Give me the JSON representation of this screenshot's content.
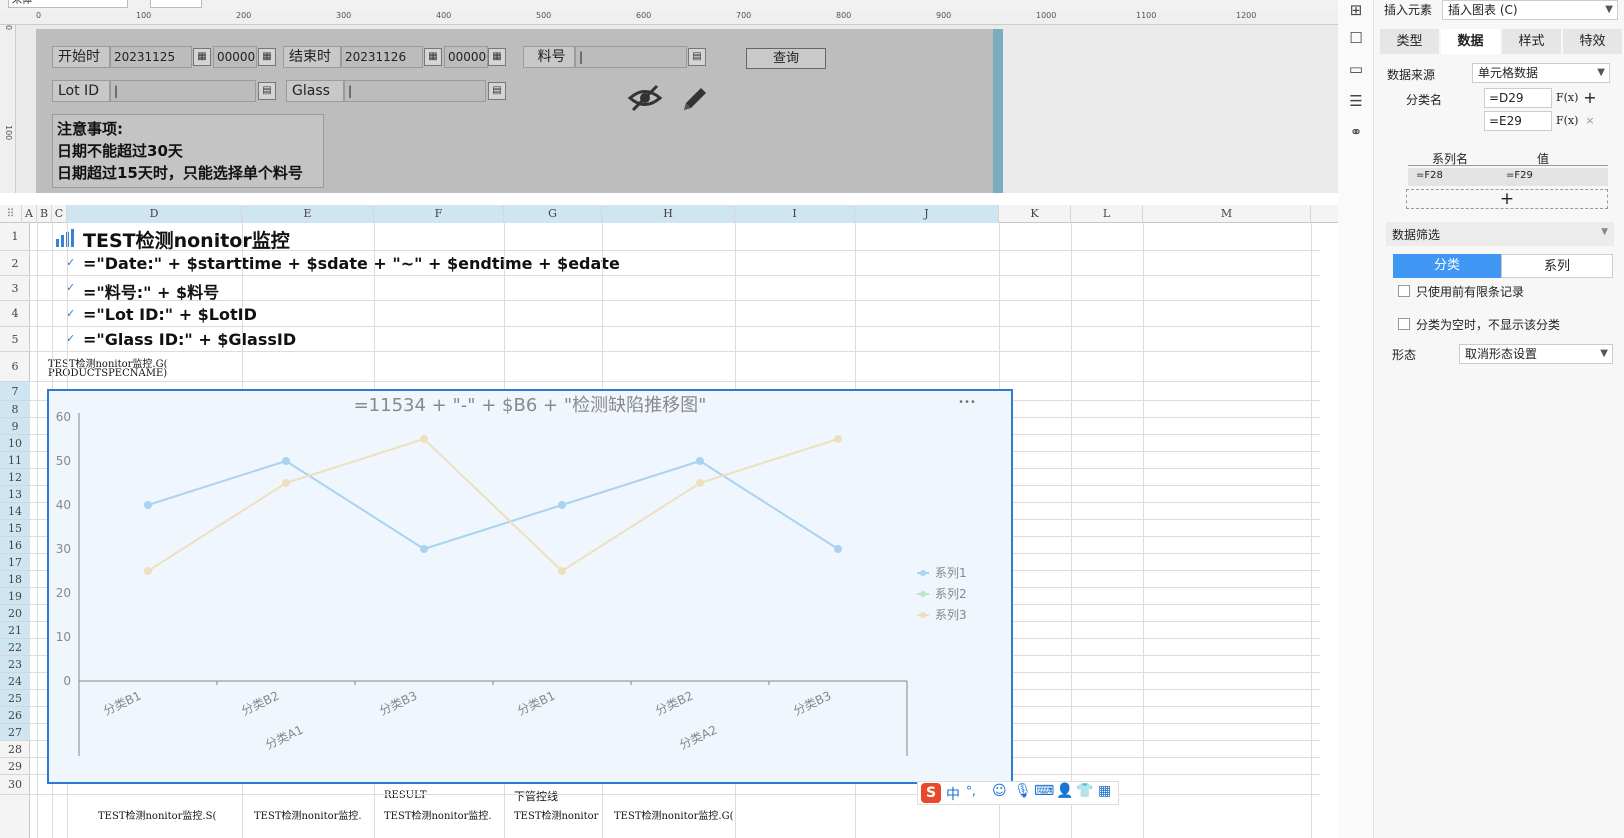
{
  "toolbar": {
    "font_name": "宋体"
  },
  "ruler": {
    "ticks": [
      "0",
      "100",
      "200",
      "300",
      "400",
      "500",
      "600",
      "700",
      "800",
      "900",
      "1000",
      "1100",
      "1200"
    ],
    "vticks": [
      "0",
      "100"
    ]
  },
  "params": {
    "start_label": "开始时",
    "start_date": "20231125",
    "start_time": "000000",
    "end_label": "结束时",
    "end_date": "20231126",
    "end_time": "000000",
    "part_label": "料号",
    "lot_label": "Lot ID",
    "glass_label": "Glass",
    "query_button": "查询",
    "notes": {
      "title": "注意事项:",
      "line1": "日期不能超过30天",
      "line2": "日期超过15天时，只能选择单个料号"
    }
  },
  "sheet": {
    "columns": [
      "A",
      "B",
      "C",
      "D",
      "E",
      "F",
      "G",
      "H",
      "I",
      "J",
      "K",
      "L",
      "M"
    ],
    "rows": [
      "1",
      "2",
      "3",
      "4",
      "5",
      "6",
      "7",
      "8",
      "9",
      "10",
      "11",
      "12",
      "13",
      "14",
      "15",
      "16",
      "17",
      "18",
      "19",
      "20",
      "21",
      "22",
      "23",
      "24",
      "25",
      "26",
      "27",
      "28",
      "29",
      "30"
    ],
    "title": "TEST检测nonitor监控",
    "formula_date": "=\"Date:\" + $starttime + $sdate + \"~\" + $endtime + $edate",
    "formula_part": "=\"料号:\" + $料号",
    "formula_lot": "=\"Lot ID:\" + $LotID",
    "formula_glass": "=\"Glass ID:\" + $GlassID",
    "b6_line1": "TEST检测nonitor监控.G(",
    "b6_line2": "PRODUCTSPECNAME)",
    "f28": "RESULT",
    "g28": "下管控线",
    "row29": [
      "TEST检测nonitor监控.S(",
      "TEST检测nonitor监控.",
      "TEST检测nonitor监控.",
      "TEST检测nonitor",
      "TEST检测nonitor监控.G("
    ],
    "check_mark": "✓"
  },
  "chart_data": {
    "type": "line",
    "title": "=11534 + \"-\" + $B6 + \"检测缺陷推移图\"",
    "categories": [
      "分类B1",
      "分类B2",
      "分类B3",
      "分类B1",
      "分类B2",
      "分类B3"
    ],
    "groups": [
      "分类A1",
      "分类A2"
    ],
    "ylim": [
      0,
      60
    ],
    "yticks": [
      "0",
      "10",
      "20",
      "30",
      "40",
      "50",
      "60"
    ],
    "series": [
      {
        "name": "系列1",
        "values": [
          40,
          50,
          30,
          40,
          50,
          30
        ],
        "color": "#a9d3f0"
      },
      {
        "name": "系列2",
        "values": [],
        "color": "#b8e6c6"
      },
      {
        "name": "系列3",
        "values": [
          25,
          45,
          55,
          25,
          45,
          55
        ],
        "color": "#ede0bd"
      }
    ],
    "legend": "right",
    "grid": false,
    "menu_glyph": "•••"
  },
  "ime": {
    "logo": "S",
    "lang": "中",
    "punct": "°,"
  },
  "panel": {
    "insert_label": "插入元素",
    "insert_value": "插入图表 (C)",
    "tabs": [
      "类型",
      "数据",
      "样式",
      "特效"
    ],
    "active_tab": "数据",
    "source_label": "数据来源",
    "source_value": "单元格数据",
    "category_label": "分类名",
    "category_values": [
      "=D29",
      "=E29"
    ],
    "fx": "F(x)",
    "series_header": "系列名",
    "value_header": "值",
    "series_cell": "=F28",
    "value_cell": "=F29",
    "add": "+",
    "filter_label": "数据筛选",
    "seg_tabs": [
      "分类",
      "系列"
    ],
    "opt1": "只使用前有限条记录",
    "opt2": "分类为空时，不显示该分类",
    "shape_label": "形态",
    "shape_value": "取消形态设置"
  }
}
